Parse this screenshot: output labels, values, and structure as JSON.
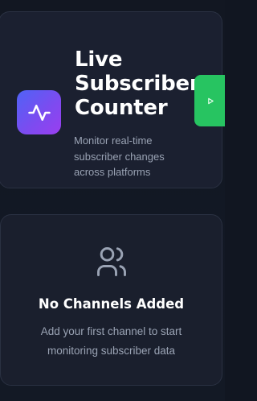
{
  "header": {
    "icon": "activity-icon",
    "title_lines": [
      "Live",
      "Subscriber",
      "Counter"
    ],
    "subtitle": "Monitor real-time subscriber changes across platforms",
    "start_button": {
      "icon": "play-icon"
    }
  },
  "empty_state": {
    "icon": "users-icon",
    "title": "No Channels Added",
    "description": "Add your first channel to start monitoring subscriber data"
  },
  "colors": {
    "background": "#121722",
    "card": "#1b2030",
    "accent_gradient_start": "#4f63f6",
    "accent_gradient_end": "#9a3ef0",
    "start_button": "#27c461",
    "muted_text": "#9aa3b4"
  }
}
